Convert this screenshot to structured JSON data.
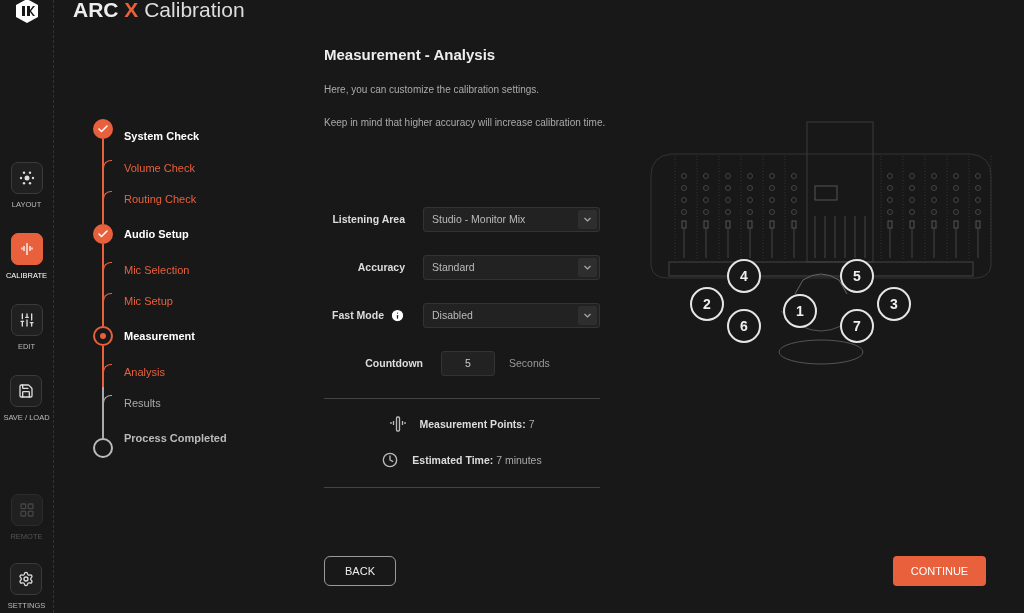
{
  "app_title": {
    "brand": "ARC",
    "mark": "X",
    "name": "Calibration"
  },
  "nav": [
    {
      "kind": "layout",
      "label": "LAYOUT",
      "selected": false,
      "disabled": false
    },
    {
      "kind": "calibrate",
      "label": "CALIBRATE",
      "selected": true,
      "disabled": false
    },
    {
      "kind": "edit",
      "label": "EDIT",
      "selected": false,
      "disabled": false
    },
    {
      "kind": "save",
      "label": "SAVE / LOAD",
      "selected": false,
      "disabled": false
    },
    {
      "kind": "remote",
      "label": "REMOTE",
      "selected": false,
      "disabled": true
    },
    {
      "kind": "settings",
      "label": "SETTINGS",
      "selected": false,
      "disabled": false
    }
  ],
  "steps": [
    {
      "label": "System Check",
      "done": true,
      "current": false,
      "children": [
        {
          "label": "Volume Check",
          "reached": true
        },
        {
          "label": "Routing Check",
          "reached": true
        }
      ]
    },
    {
      "label": "Audio Setup",
      "done": true,
      "current": false,
      "children": [
        {
          "label": "Mic Selection",
          "reached": true
        },
        {
          "label": "Mic Setup",
          "reached": true
        }
      ]
    },
    {
      "label": "Measurement",
      "done": false,
      "current": true,
      "children": [
        {
          "label": "Analysis",
          "reached": true
        },
        {
          "label": "Results",
          "reached": false
        }
      ]
    },
    {
      "label": "Process Completed",
      "done": false,
      "current": false
    }
  ],
  "heading": "Measurement - Analysis",
  "intro": [
    "Here, you can customize the calibration settings.",
    "Keep in mind that higher accuracy will increase calibration time."
  ],
  "settings": [
    {
      "kind": "select",
      "label": "Listening Area",
      "value": "Studio - Monitor Mix",
      "info": false
    },
    {
      "kind": "select",
      "label": "Accuracy",
      "value": "Standard",
      "info": false
    },
    {
      "kind": "select",
      "label": "Fast Mode",
      "value": "Disabled",
      "info": true
    },
    {
      "kind": "number",
      "label": "Countdown",
      "value": "5",
      "unit": "Seconds",
      "info": false
    }
  ],
  "summary": [
    {
      "kind": "points",
      "label": "Measurement Points:",
      "value": "7"
    },
    {
      "kind": "time",
      "label": "Estimated Time:",
      "value": "7 minutes"
    }
  ],
  "positions": [
    "1",
    "2",
    "3",
    "4",
    "5",
    "6",
    "7"
  ],
  "buttons": {
    "back": "BACK",
    "continue": "CONTINUE"
  }
}
